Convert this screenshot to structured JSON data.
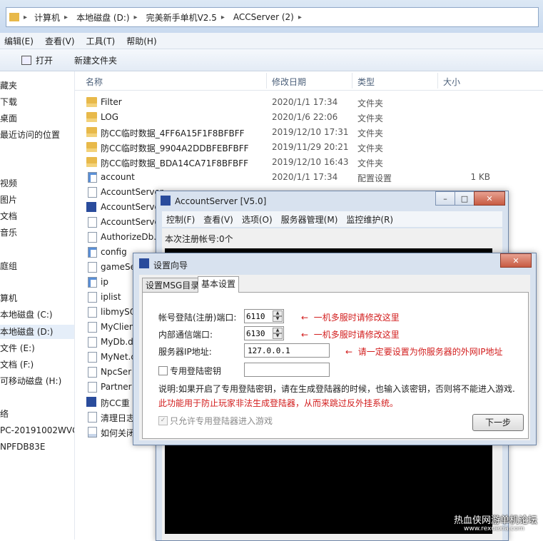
{
  "address": [
    "计算机",
    "本地磁盘 (D:)",
    "完美新手单机V2.5",
    "ACCServer (2)"
  ],
  "menubar": [
    "编辑(E)",
    "查看(V)",
    "工具(T)",
    "帮助(H)"
  ],
  "toolbar": {
    "open": "打开",
    "new_folder": "新建文件夹"
  },
  "nav": [
    "藏夹",
    "下载",
    "桌面",
    "最近访问的位置",
    "视频",
    "图片",
    "文档",
    "音乐",
    "庭组",
    "算机",
    "本地磁盘 (C:)",
    "本地磁盘 (D:)",
    "文件 (E:)",
    "文档 (F:)",
    "可移动磁盘 (H:)",
    "络",
    "PC-20191002WVG",
    "NPFDB83E"
  ],
  "columns": {
    "name": "名称",
    "date": "修改日期",
    "type": "类型",
    "size": "大小"
  },
  "files": [
    {
      "name": "Filter",
      "date": "2020/1/1 17:34",
      "type": "文件夹",
      "size": "",
      "icon": "folder"
    },
    {
      "name": "LOG",
      "date": "2020/1/6 22:06",
      "type": "文件夹",
      "size": "",
      "icon": "folder"
    },
    {
      "name": "防CC临时数据_4FF6A15F1F8BFBFF",
      "date": "2019/12/10 17:31",
      "type": "文件夹",
      "size": "",
      "icon": "folder"
    },
    {
      "name": "防CC临时数据_9904A2DDBFEBFBFF",
      "date": "2019/11/29 20:21",
      "type": "文件夹",
      "size": "",
      "icon": "folder"
    },
    {
      "name": "防CC临时数据_BDA14CA71F8BFBFF",
      "date": "2019/12/10 16:43",
      "type": "文件夹",
      "size": "",
      "icon": "folder"
    },
    {
      "name": "account",
      "date": "2020/1/1 17:34",
      "type": "配置设置",
      "size": "1 KB",
      "icon": "config"
    },
    {
      "name": "AccountServer",
      "date": "",
      "type": "",
      "size": "",
      "icon": "file"
    },
    {
      "name": "AccountServer",
      "date": "",
      "type": "",
      "size": "",
      "icon": "exe"
    },
    {
      "name": "AccountServer",
      "date": "",
      "type": "",
      "size": "",
      "icon": "file"
    },
    {
      "name": "AuthorizeDb.",
      "date": "",
      "type": "",
      "size": "",
      "icon": "file"
    },
    {
      "name": "config",
      "date": "",
      "type": "",
      "size": "",
      "icon": "config"
    },
    {
      "name": "gameSe",
      "date": "",
      "type": "",
      "size": "",
      "icon": "file"
    },
    {
      "name": "ip",
      "date": "",
      "type": "",
      "size": "",
      "icon": "config"
    },
    {
      "name": "iplist",
      "date": "",
      "type": "",
      "size": "",
      "icon": "file"
    },
    {
      "name": "libmySQ",
      "date": "",
      "type": "",
      "size": "",
      "icon": "file"
    },
    {
      "name": "MyClien",
      "date": "",
      "type": "",
      "size": "",
      "icon": "file"
    },
    {
      "name": "MyDb.d",
      "date": "",
      "type": "",
      "size": "",
      "icon": "file"
    },
    {
      "name": "MyNet.c",
      "date": "",
      "type": "",
      "size": "",
      "icon": "file"
    },
    {
      "name": "NpcSer",
      "date": "",
      "type": "",
      "size": "",
      "icon": "file"
    },
    {
      "name": "Partner",
      "date": "",
      "type": "",
      "size": "",
      "icon": "file"
    },
    {
      "name": "防CC重",
      "date": "",
      "type": "",
      "size": "",
      "icon": "exe"
    },
    {
      "name": "清理日志",
      "date": "",
      "type": "",
      "size": "",
      "icon": "file"
    },
    {
      "name": "如何关闭",
      "date": "",
      "type": "",
      "size": "",
      "icon": "txt"
    }
  ],
  "account_window": {
    "title": "AccountServer [V5.0]",
    "menu": [
      "控制(F)",
      "查看(V)",
      "选项(O)",
      "服务器管理(M)",
      "监控维护(R)"
    ],
    "reg_count": "本次注册帐号:0个"
  },
  "wizard": {
    "title": "设置向导",
    "tabs": [
      "设置MSG目录",
      "基本设置"
    ],
    "account_port_label": "帐号登陆(注册)端口:",
    "account_port": "6110",
    "internal_port_label": "内部通信端口:",
    "internal_port": "6130",
    "server_ip_label": "服务器IP地址:",
    "server_ip": "127.0.0.1",
    "note_multi": "一机多服时请修改这里",
    "note_multi2": "一机多服时请修改这里",
    "note_ip": "请一定要设置为你服务器的外网IP地址",
    "private_key_label": "专用登陆密钥",
    "private_key_value": "",
    "desc1": "说明:如果开启了专用登陆密钥，请在生成登陆器的时候，也输入该密钥，否则将不能进入游戏.",
    "desc2": "此功能用于防止玩家非法生成登陆器，从而来跳过反外挂系统。",
    "only_allow_label": "只允许专用登陆器进入游戏",
    "next_button": "下一步"
  },
  "watermark": "热血侠网游单机论坛",
  "watermark_url": "www.rexuexia.com"
}
